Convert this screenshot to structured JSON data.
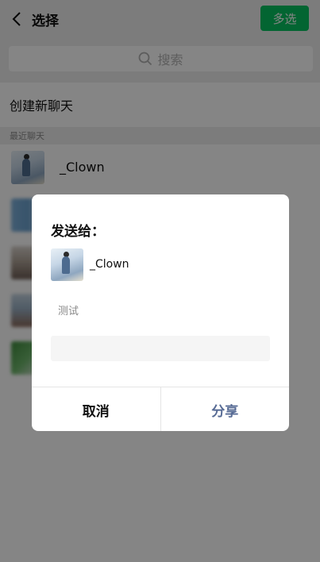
{
  "header": {
    "title": "选择",
    "multi_select_label": "多选"
  },
  "search": {
    "placeholder": "搜索"
  },
  "create_chat_label": "创建新聊天",
  "recent_section_label": "最近聊天",
  "chats": [
    {
      "name": "_Clown"
    }
  ],
  "dialog": {
    "title": "发送给：",
    "recipient_name": "_Clown",
    "message": "测试",
    "cancel_label": "取消",
    "share_label": "分享"
  },
  "colors": {
    "accent_green": "#07c160",
    "share_blue": "#576b95"
  }
}
